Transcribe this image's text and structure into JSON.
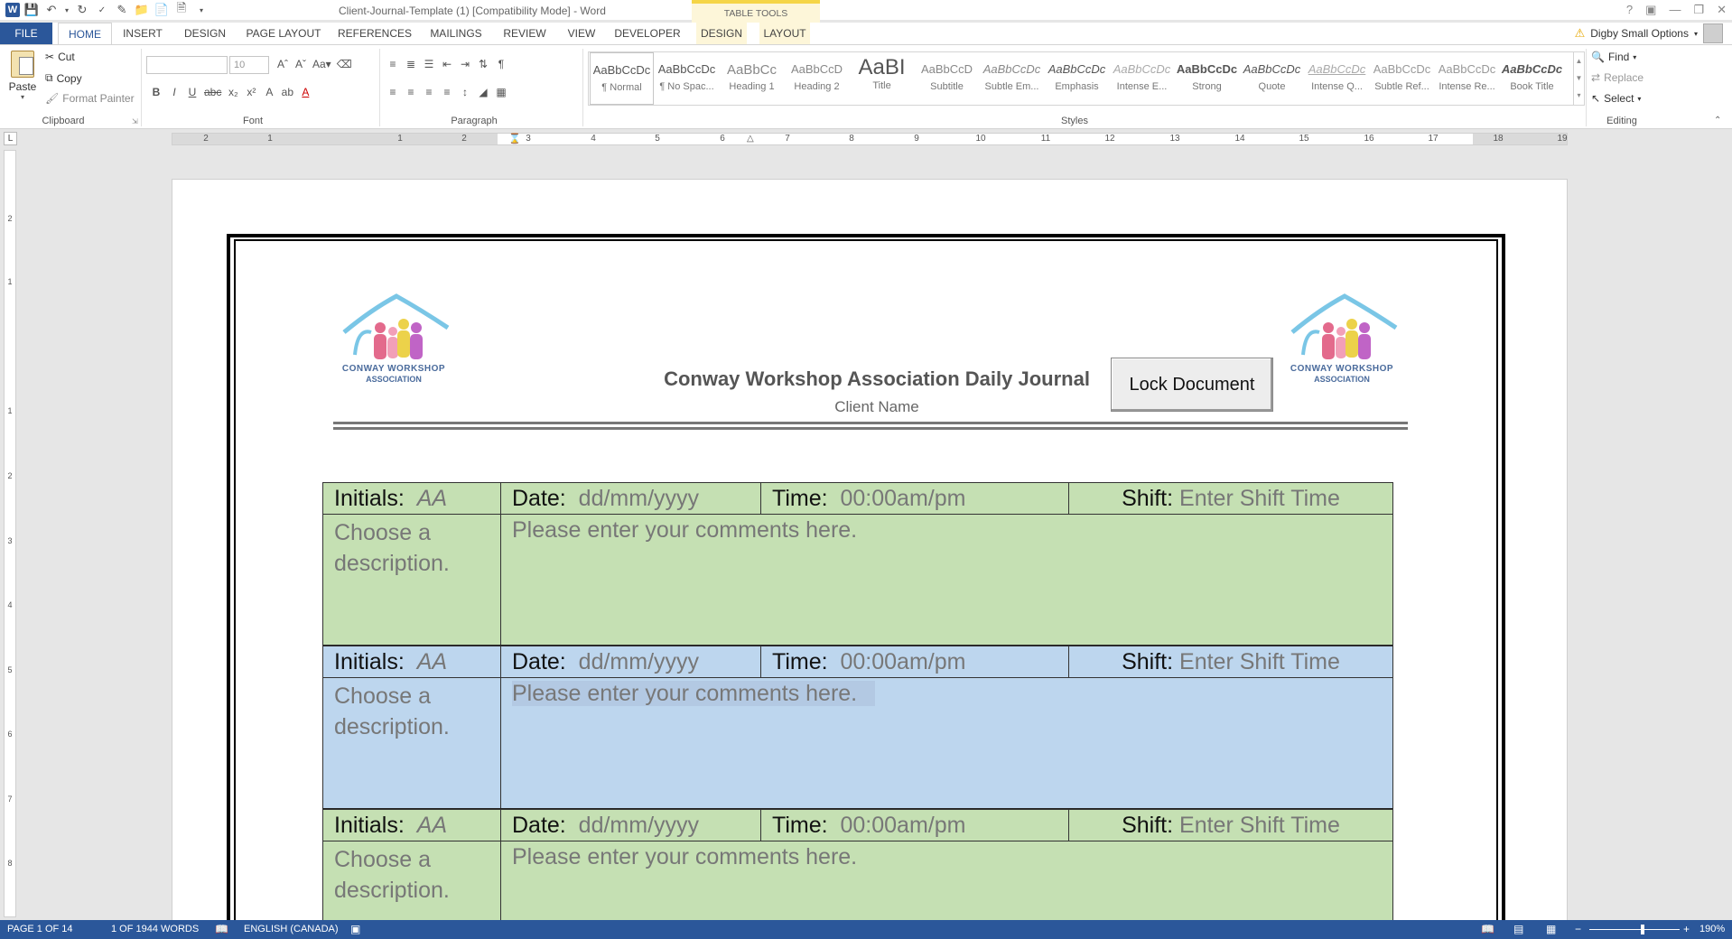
{
  "titlebar": {
    "doc_title": "Client-Journal-Template (1) [Compatibility Mode] - Word",
    "contextual_group": "TABLE TOOLS",
    "help": "?",
    "window_controls": [
      "restore-ribbon",
      "minimize",
      "maximize",
      "close"
    ]
  },
  "tabs": {
    "file": "FILE",
    "home": "HOME",
    "insert": "INSERT",
    "design": "DESIGN",
    "page_layout": "PAGE LAYOUT",
    "references": "REFERENCES",
    "mailings": "MAILINGS",
    "review": "REVIEW",
    "view": "VIEW",
    "developer": "DEVELOPER",
    "table_design": "DESIGN",
    "table_layout": "LAYOUT"
  },
  "user": {
    "name": "Digby Small Options"
  },
  "clipboard": {
    "paste": "Paste",
    "cut": "Cut",
    "copy": "Copy",
    "format_painter": "Format Painter",
    "label": "Clipboard"
  },
  "font": {
    "size": "10",
    "label": "Font"
  },
  "paragraph": {
    "label": "Paragraph"
  },
  "styles": {
    "label": "Styles",
    "items": [
      {
        "sample": "AaBbCcDc",
        "name": "¶ Normal"
      },
      {
        "sample": "AaBbCcDc",
        "name": "¶ No Spac..."
      },
      {
        "sample": "AaBbCc",
        "name": "Heading 1"
      },
      {
        "sample": "AaBbCcD",
        "name": "Heading 2"
      },
      {
        "sample": "AaBI",
        "name": "Title"
      },
      {
        "sample": "AaBbCcD",
        "name": "Subtitle"
      },
      {
        "sample": "AaBbCcDc",
        "name": "Subtle Em..."
      },
      {
        "sample": "AaBbCcDc",
        "name": "Emphasis"
      },
      {
        "sample": "AaBbCcDc",
        "name": "Intense E..."
      },
      {
        "sample": "AaBbCcDc",
        "name": "Strong"
      },
      {
        "sample": "AaBbCcDc",
        "name": "Quote"
      },
      {
        "sample": "AaBbCcDc",
        "name": "Intense Q..."
      },
      {
        "sample": "AaBbCcDc",
        "name": "Subtle Ref..."
      },
      {
        "sample": "AaBbCcDc",
        "name": "Intense Re..."
      },
      {
        "sample": "AaBbCcDc",
        "name": "Book Title"
      }
    ]
  },
  "editing": {
    "find": "Find",
    "replace": "Replace",
    "select": "Select",
    "label": "Editing"
  },
  "ruler": {
    "corner": "L",
    "numbers": [
      "2",
      "1",
      "1",
      "2",
      "3",
      "4",
      "5",
      "6",
      "7",
      "8",
      "9",
      "10",
      "11",
      "12",
      "13",
      "14",
      "15",
      "16",
      "17",
      "18",
      "19"
    ],
    "vnumbers": [
      "2",
      "1",
      "1",
      "2",
      "3",
      "4",
      "5",
      "6",
      "7",
      "8"
    ]
  },
  "document": {
    "logo_line1": "CONWAY WORKSHOP",
    "logo_line2": "ASSOCIATION",
    "heading": "Conway Workshop Association Daily Journal",
    "client_name": "Client Name",
    "lock_button": "Lock Document",
    "entries": [
      {
        "initials_label": "Initials:",
        "initials_value": "AA",
        "date_label": "Date:",
        "date_value": "dd/mm/yyyy",
        "time_label": "Time:",
        "time_value": "00:00am/pm",
        "shift_label": "Shift:",
        "shift_value": "Enter Shift Time",
        "description": "Choose a description.",
        "comments": "Please enter your comments here."
      },
      {
        "initials_label": "Initials:",
        "initials_value": "AA",
        "date_label": "Date:",
        "date_value": "dd/mm/yyyy",
        "time_label": "Time:",
        "time_value": "00:00am/pm",
        "shift_label": "Shift:",
        "shift_value": "Enter Shift Time",
        "description": "Choose a description.",
        "comments": "Please enter your comments here."
      },
      {
        "initials_label": "Initials:",
        "initials_value": "AA",
        "date_label": "Date:",
        "date_value": "dd/mm/yyyy",
        "time_label": "Time:",
        "time_value": "00:00am/pm",
        "shift_label": "Shift:",
        "shift_value": "Enter Shift Time",
        "description": "Choose a description.",
        "comments": "Please enter your comments here."
      }
    ]
  },
  "statusbar": {
    "page": "PAGE 1 OF 14",
    "words": "1 OF 1944 WORDS",
    "language": "ENGLISH (CANADA)",
    "zoom": "190%"
  },
  "colors": {
    "brand": "#2b579a",
    "row_green": "#c5e0b3",
    "row_blue": "#bdd6ee",
    "table_tools": "#f5d547"
  }
}
